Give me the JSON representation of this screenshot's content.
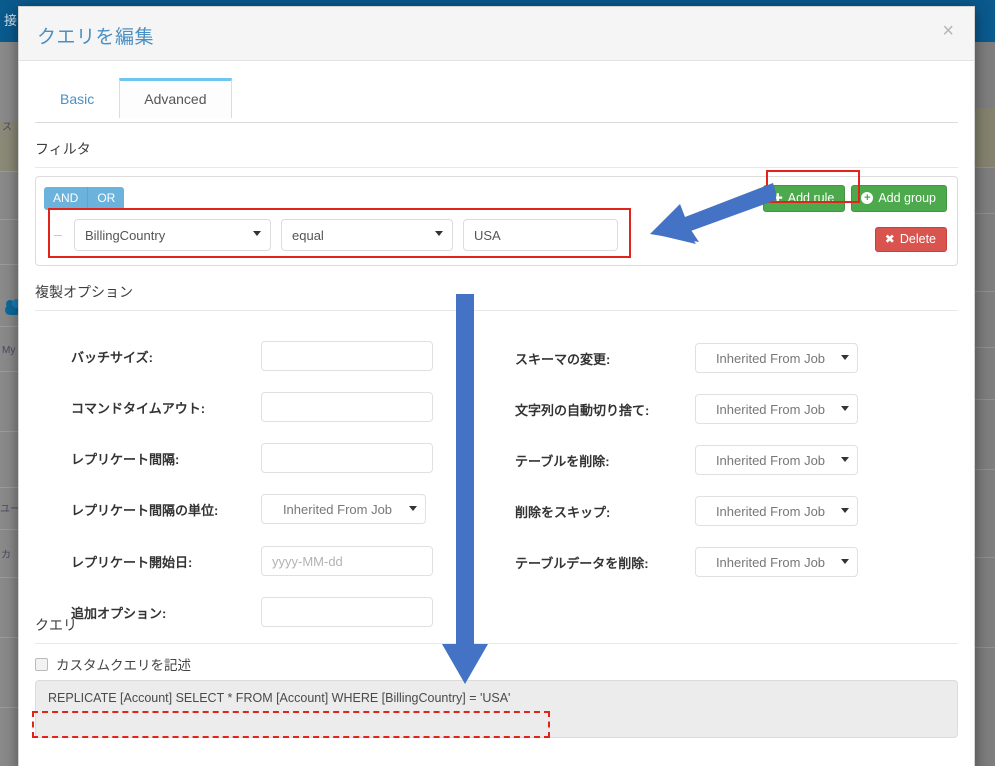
{
  "background": {
    "topbar_label": "接",
    "sidebar_fragments": [
      "ス",
      "My",
      "ユー",
      "カ"
    ]
  },
  "modal": {
    "title": "クエリを編集",
    "close_label": "×"
  },
  "tabs": [
    {
      "label": "Basic",
      "active": false
    },
    {
      "label": "Advanced",
      "active": true
    }
  ],
  "filter": {
    "section_title": "フィルタ",
    "and_label": "AND",
    "or_label": "OR",
    "add_rule_label": "Add rule",
    "add_group_label": "Add group",
    "delete_label": "Delete",
    "rule": {
      "field": "BillingCountry",
      "operator": "equal",
      "value": "USA"
    }
  },
  "options": {
    "section_title": "複製オプション",
    "left": [
      {
        "label": "バッチサイズ:",
        "type": "input",
        "value": "",
        "placeholder": ""
      },
      {
        "label": "コマンドタイムアウト:",
        "type": "input",
        "value": "",
        "placeholder": ""
      },
      {
        "label": "レプリケート間隔:",
        "type": "input",
        "value": "",
        "placeholder": ""
      },
      {
        "label": "レプリケート間隔の単位:",
        "type": "select",
        "value": "Inherited From Job"
      },
      {
        "label": "レプリケート開始日:",
        "type": "input",
        "value": "",
        "placeholder": "yyyy-MM-dd"
      },
      {
        "label": "追加オプション:",
        "type": "input",
        "value": "",
        "placeholder": ""
      }
    ],
    "right": [
      {
        "label": "スキーマの変更:",
        "type": "select",
        "value": "Inherited From Job"
      },
      {
        "label": "文字列の自動切り捨て:",
        "type": "select",
        "value": "Inherited From Job"
      },
      {
        "label": "テーブルを削除:",
        "type": "select",
        "value": "Inherited From Job"
      },
      {
        "label": "削除をスキップ:",
        "type": "select",
        "value": "Inherited From Job"
      },
      {
        "label": "テーブルデータを削除:",
        "type": "select",
        "value": "Inherited From Job"
      }
    ]
  },
  "query": {
    "section_title": "クエリ",
    "custom_query_label": "カスタムクエリを記述",
    "custom_query_checked": false,
    "sql": "REPLICATE [Account] SELECT * FROM [Account] WHERE [BillingCountry] = 'USA'"
  },
  "colors": {
    "accent_blue": "#4a90c4",
    "tab_active_border": "#6fc4f0",
    "andor_blue": "#6bb3dd",
    "green": "#4ca94c",
    "red": "#d9534f",
    "annotation_red": "#e2231a",
    "arrow_blue": "#4472C4",
    "topbar_blue": "#0a5a8e"
  }
}
